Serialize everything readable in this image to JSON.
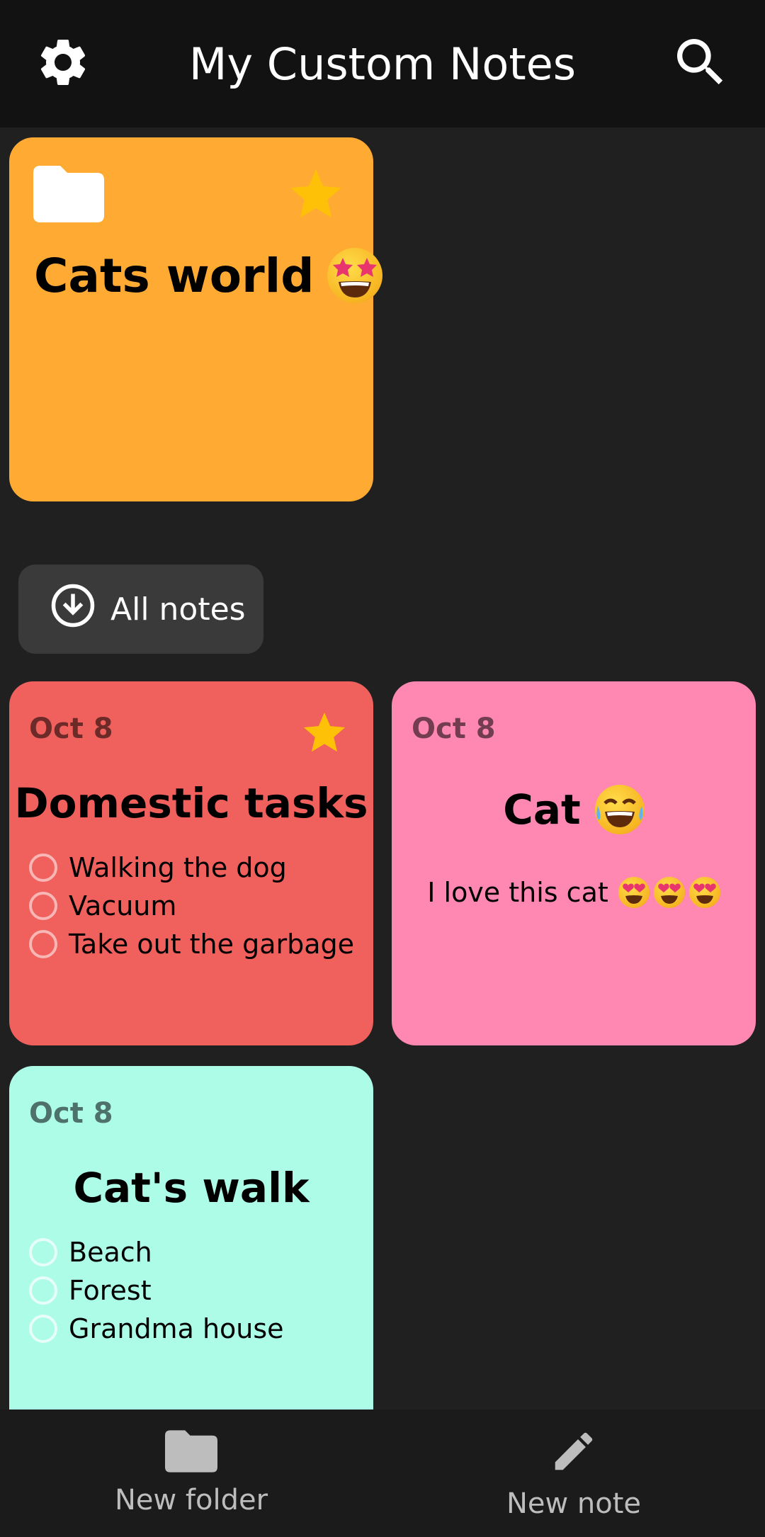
{
  "header": {
    "title": "My Custom Notes",
    "settings_icon": "gear-icon",
    "search_icon": "search-icon"
  },
  "folders": [
    {
      "title": "Cats world",
      "emoji": "star-struck-emoji",
      "color": "#ffab33",
      "starred": true
    }
  ],
  "all_notes_label": "All notes",
  "notes": [
    {
      "date": "Oct 8",
      "title": "Domestic tasks",
      "color": "#f0605c",
      "starred": true,
      "items": [
        "Walking the dog",
        "Vacuum",
        "Take out the garbage"
      ]
    },
    {
      "date": "Oct 8",
      "title": "Cat",
      "title_emoji": "tears-of-joy-emoji",
      "body": "I love this cat",
      "body_emojis": [
        "heart-eyes-emoji",
        "heart-eyes-emoji",
        "heart-eyes-emoji"
      ],
      "color": "#fe88b1",
      "starred": false
    },
    {
      "date": "Oct 8",
      "title": "Cat's walk",
      "color": "#adfce8",
      "starred": false,
      "items": [
        "Beach",
        "Forest",
        "Grandma house"
      ]
    }
  ],
  "bottom_nav": {
    "new_folder": "New folder",
    "new_note": "New note"
  },
  "colors": {
    "background": "#202020",
    "header": "#121212",
    "star": "#ffc107"
  }
}
